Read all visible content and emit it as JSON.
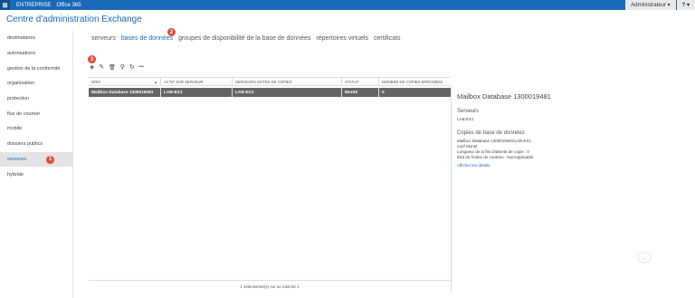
{
  "topbar": {
    "logo_glyph": "⊞",
    "app_name": "ENTREPRISE",
    "suite_name": "Office 365",
    "admin_label": "Administrateur ▾",
    "help_label": "? ▾"
  },
  "page_title": "Centre d'administration Exchange",
  "sidebar": {
    "items": [
      {
        "label": "destinataires"
      },
      {
        "label": "autorisations"
      },
      {
        "label": "gestion de la conformité"
      },
      {
        "label": "organisation"
      },
      {
        "label": "protection"
      },
      {
        "label": "flux de courrier"
      },
      {
        "label": "mobile"
      },
      {
        "label": "dossiers publics"
      },
      {
        "label": "serveurs"
      },
      {
        "label": "hybride"
      }
    ],
    "active_index": 8
  },
  "tabs": [
    {
      "label": "serveurs"
    },
    {
      "label": "bases de données"
    },
    {
      "label": "groupes de disponibilité de la base de données"
    },
    {
      "label": "répertoires virtuels"
    },
    {
      "label": "certificats"
    }
  ],
  "toolbar": {
    "add": "+",
    "edit": "✎",
    "delete": "🗑",
    "search": "⚲",
    "refresh": "↻",
    "more": "•••"
  },
  "badges": {
    "one": "1",
    "two": "2",
    "three": "3"
  },
  "table": {
    "headers": [
      "NOM",
      "ACTIF SUR SERVEUR",
      "SERVEURS DOTÉS DE COPIES",
      "STATUT",
      "NOMBRE DE COPIES ERRONÉES"
    ],
    "sort_indicator": "▲",
    "rows": [
      [
        "Mailbox Database 1300019481",
        "LAB-EX1",
        "LAB-EX1",
        "Monté",
        "0"
      ]
    ]
  },
  "detail": {
    "name": "Mailbox Database 1300019481",
    "servers_heading": "Serveurs",
    "servers_value": "LAB-EX1",
    "copies_heading": "Copies de base de données",
    "copies_lines": [
      "Mailbox Database 1300019481\\LAB-EX1",
      "Actif Monté",
      "Longueur de la file d'attente de copie : 0",
      "État de l'index de contenu : NonApplicable"
    ],
    "details_link": "Afficher les détails"
  },
  "status_text": "1 sélectionné(s) sur un total de 1",
  "colors": {
    "accent": "#1a69b8",
    "badge": "#e04b3a",
    "selected_row": "#656565"
  }
}
